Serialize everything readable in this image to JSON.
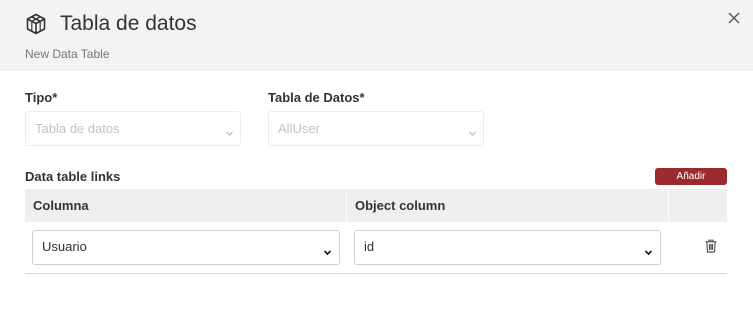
{
  "header": {
    "title": "Tabla de datos",
    "subtitle": "New Data Table",
    "icon": "cube-icon",
    "close_icon": "close-icon"
  },
  "form": {
    "tipo_label": "Tipo*",
    "tipo_value": "Tabla de datos",
    "tabla_label": "Tabla de Datos*",
    "tabla_value": "AllUser"
  },
  "links": {
    "section_label": "Data table links",
    "add_button": "Añadir",
    "columns": [
      "Columna",
      "Object column"
    ],
    "rows": [
      {
        "columna": "Usuario",
        "object_column": "id",
        "delete_icon": "trash-icon"
      }
    ]
  },
  "colors": {
    "accent": "#9b2a2e",
    "header_bg": "#f3f3f3",
    "table_header_bg": "#efefef"
  }
}
